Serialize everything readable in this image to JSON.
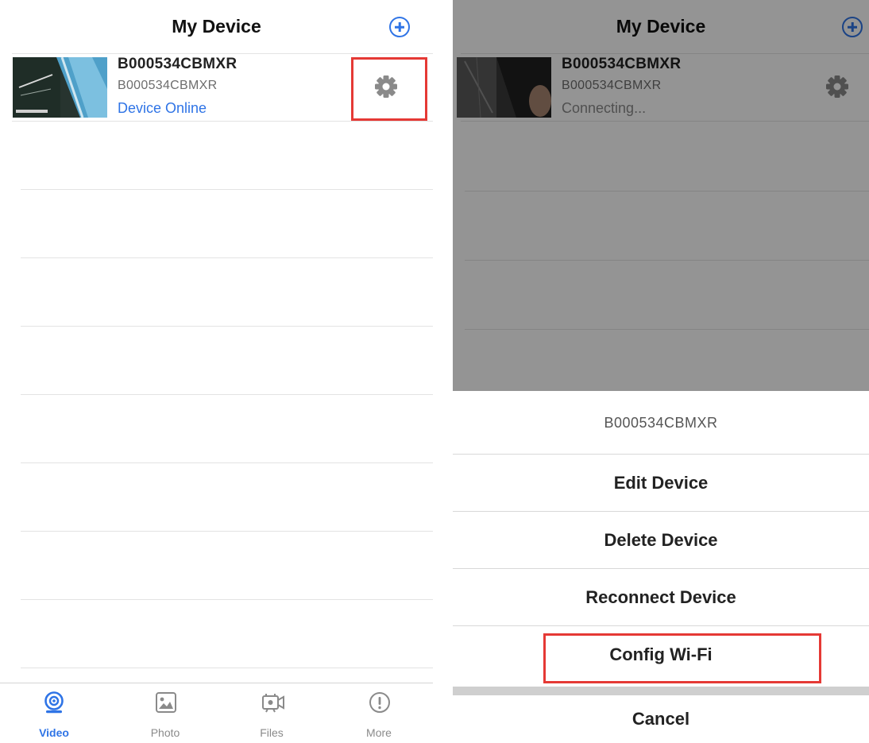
{
  "left": {
    "nav_title": "My Device",
    "device": {
      "name": "B000534CBMXR",
      "id": "B000534CBMXR",
      "status": "Device Online"
    },
    "tabs": [
      {
        "label": "Video",
        "icon": "video-camera-icon",
        "active": true
      },
      {
        "label": "Photo",
        "icon": "photo-icon",
        "active": false
      },
      {
        "label": "Files",
        "icon": "files-icon",
        "active": false
      },
      {
        "label": "More",
        "icon": "more-info-icon",
        "active": false
      }
    ]
  },
  "right": {
    "nav_title": "My Device",
    "device": {
      "name": "B000534CBMXR",
      "id": "B000534CBMXR",
      "status": "Connecting..."
    },
    "sheet": {
      "title": "B000534CBMXR",
      "items": [
        "Edit Device",
        "Delete Device",
        "Reconnect Device",
        "Config Wi-Fi"
      ],
      "cancel": "Cancel"
    }
  },
  "colors": {
    "accent": "#2f74e6",
    "highlight": "#e53935"
  }
}
